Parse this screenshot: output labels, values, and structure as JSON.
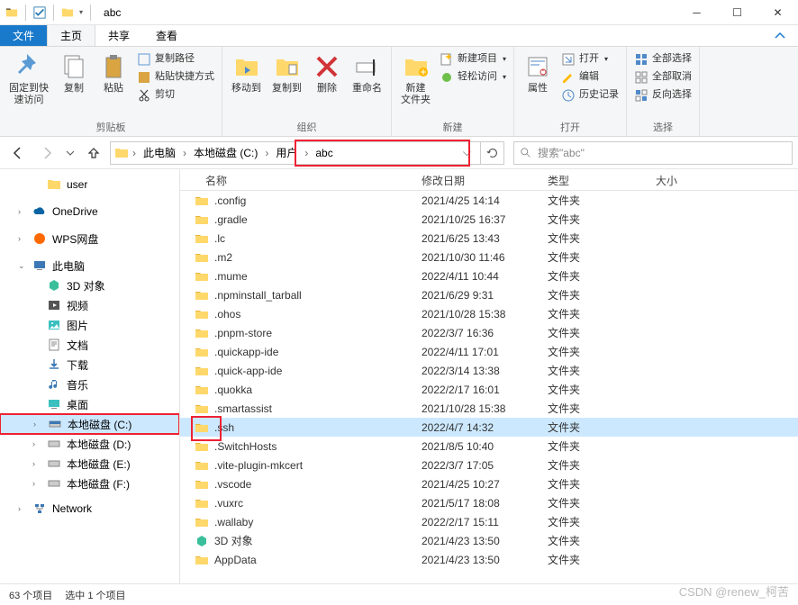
{
  "window": {
    "title": "abc"
  },
  "tabs": {
    "file": "文件",
    "home": "主页",
    "share": "共享",
    "view": "查看"
  },
  "ribbon": {
    "pin": "固定到快\n速访问",
    "copy": "复制",
    "paste": "粘贴",
    "copypath": "复制路径",
    "pasteshortcut": "粘贴快捷方式",
    "cut": "剪切",
    "clipboard": "剪贴板",
    "moveto": "移动到",
    "copyto": "复制到",
    "delete": "删除",
    "rename": "重命名",
    "organize": "组织",
    "newfolder": "新建\n文件夹",
    "newitem": "新建项目",
    "easyaccess": "轻松访问",
    "new": "新建",
    "properties": "属性",
    "open_lbl": "打开",
    "edit": "编辑",
    "history": "历史记录",
    "open": "打开",
    "selectall": "全部选择",
    "selectnone": "全部取消",
    "invert": "反向选择",
    "select": "选择"
  },
  "breadcrumb": {
    "pc": "此电脑",
    "drive": "本地磁盘 (C:)",
    "users": "用户",
    "current": "abc"
  },
  "search": {
    "placeholder": "搜索\"abc\""
  },
  "sidebar": {
    "user": "user",
    "onedrive": "OneDrive",
    "wps": "WPS网盘",
    "pc": "此电脑",
    "objects3d": "3D 对象",
    "video": "视频",
    "pictures": "图片",
    "documents": "文档",
    "downloads": "下载",
    "music": "音乐",
    "desktop": "桌面",
    "driveC": "本地磁盘 (C:)",
    "driveD": "本地磁盘 (D:)",
    "driveE": "本地磁盘 (E:)",
    "driveF": "本地磁盘 (F:)",
    "network": "Network"
  },
  "columns": {
    "name": "名称",
    "date": "修改日期",
    "type": "类型",
    "size": "大小"
  },
  "foldertype": "文件夹",
  "rows": [
    {
      "name": ".config",
      "date": "2021/4/25 14:14"
    },
    {
      "name": ".gradle",
      "date": "2021/10/25 16:37"
    },
    {
      "name": ".lc",
      "date": "2021/6/25 13:43"
    },
    {
      "name": ".m2",
      "date": "2021/10/30 11:46"
    },
    {
      "name": ".mume",
      "date": "2022/4/11 10:44"
    },
    {
      "name": ".npminstall_tarball",
      "date": "2021/6/29 9:31"
    },
    {
      "name": ".ohos",
      "date": "2021/10/28 15:38"
    },
    {
      "name": ".pnpm-store",
      "date": "2022/3/7 16:36"
    },
    {
      "name": ".quickapp-ide",
      "date": "2022/4/11 17:01"
    },
    {
      "name": ".quick-app-ide",
      "date": "2022/3/14 13:38"
    },
    {
      "name": ".quokka",
      "date": "2022/2/17 16:01"
    },
    {
      "name": ".smartassist",
      "date": "2021/10/28 15:38"
    },
    {
      "name": ".ssh",
      "date": "2022/4/7 14:32",
      "sel": true,
      "hl": true
    },
    {
      "name": ".SwitchHosts",
      "date": "2021/8/5 10:40"
    },
    {
      "name": ".vite-plugin-mkcert",
      "date": "2022/3/7 17:05"
    },
    {
      "name": ".vscode",
      "date": "2021/4/25 10:27"
    },
    {
      "name": ".vuxrc",
      "date": "2021/5/17 18:08"
    },
    {
      "name": ".wallaby",
      "date": "2022/2/17 15:11"
    },
    {
      "name": "3D 对象",
      "date": "2021/4/23 13:50",
      "sys": true
    },
    {
      "name": "AppData",
      "date": "2021/4/23 13:50"
    }
  ],
  "status": {
    "count": "63 个项目",
    "selected": "选中 1 个项目"
  },
  "watermark": "CSDN @renew_柯苦"
}
